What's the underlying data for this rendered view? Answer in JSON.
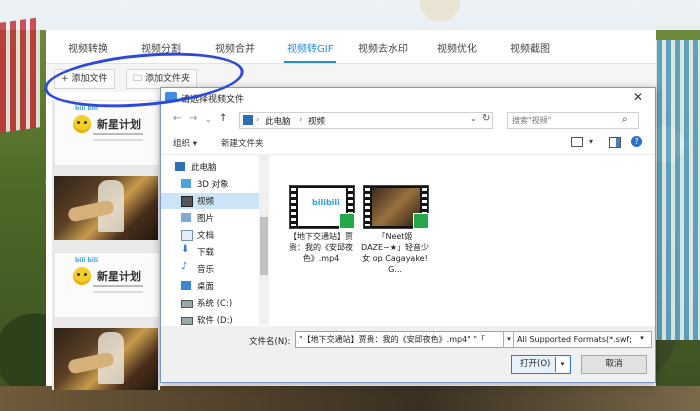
{
  "app": {
    "tabs": [
      "视频转换",
      "视频分割",
      "视频合并",
      "视频转GIF",
      "视频去水印",
      "视频优化",
      "视频截图"
    ],
    "active_tab": "视频转GIF",
    "toolbar": {
      "add_file": "添加文件",
      "add_folder": "添加文件夹"
    },
    "thumbs": [
      {
        "kind": "logo",
        "brand": "新星计划",
        "tag": "bili bili"
      },
      {
        "kind": "photo"
      },
      {
        "kind": "logo",
        "brand": "新星计划",
        "tag": "bili bili"
      },
      {
        "kind": "photo"
      }
    ]
  },
  "dialog": {
    "title": "请选择视频文件",
    "breadcrumb": [
      "此电脑",
      "视频"
    ],
    "search_placeholder": "搜索\"视频\"",
    "organize": "组织 ▾",
    "new_folder": "新建文件夹",
    "tree": [
      {
        "label": "此电脑",
        "icon": "computer-icon"
      },
      {
        "label": "3D 对象",
        "icon": "cube-icon"
      },
      {
        "label": "视频",
        "icon": "video-folder-icon",
        "selected": true
      },
      {
        "label": "图片",
        "icon": "picture-folder-icon"
      },
      {
        "label": "文档",
        "icon": "document-folder-icon"
      },
      {
        "label": "下载",
        "icon": "download-icon"
      },
      {
        "label": "音乐",
        "icon": "music-icon"
      },
      {
        "label": "桌面",
        "icon": "desktop-icon"
      },
      {
        "label": "系统 (C:)",
        "icon": "drive-icon"
      },
      {
        "label": "软件 (D:)",
        "icon": "drive-icon"
      }
    ],
    "files": [
      {
        "name": "【地下交通站】贾贵：我的《安邱夜色》.mp4",
        "thumb": "bilibili"
      },
      {
        "name": "「Neet姬DAZE~★」轻音少女 op Cagayake! G...",
        "thumb": "photo"
      }
    ],
    "filename_label": "文件名(N):",
    "filename_value": "\"【地下交通站】贾贵：我的《安邱夜色》.mp4\" \"「",
    "filter": "All Supported Formats(*.swf;",
    "open_label": "打开(O)",
    "cancel_label": "取消"
  },
  "colors": {
    "accent": "#2a8ad8",
    "annotation_circle": "#2d49d8"
  }
}
